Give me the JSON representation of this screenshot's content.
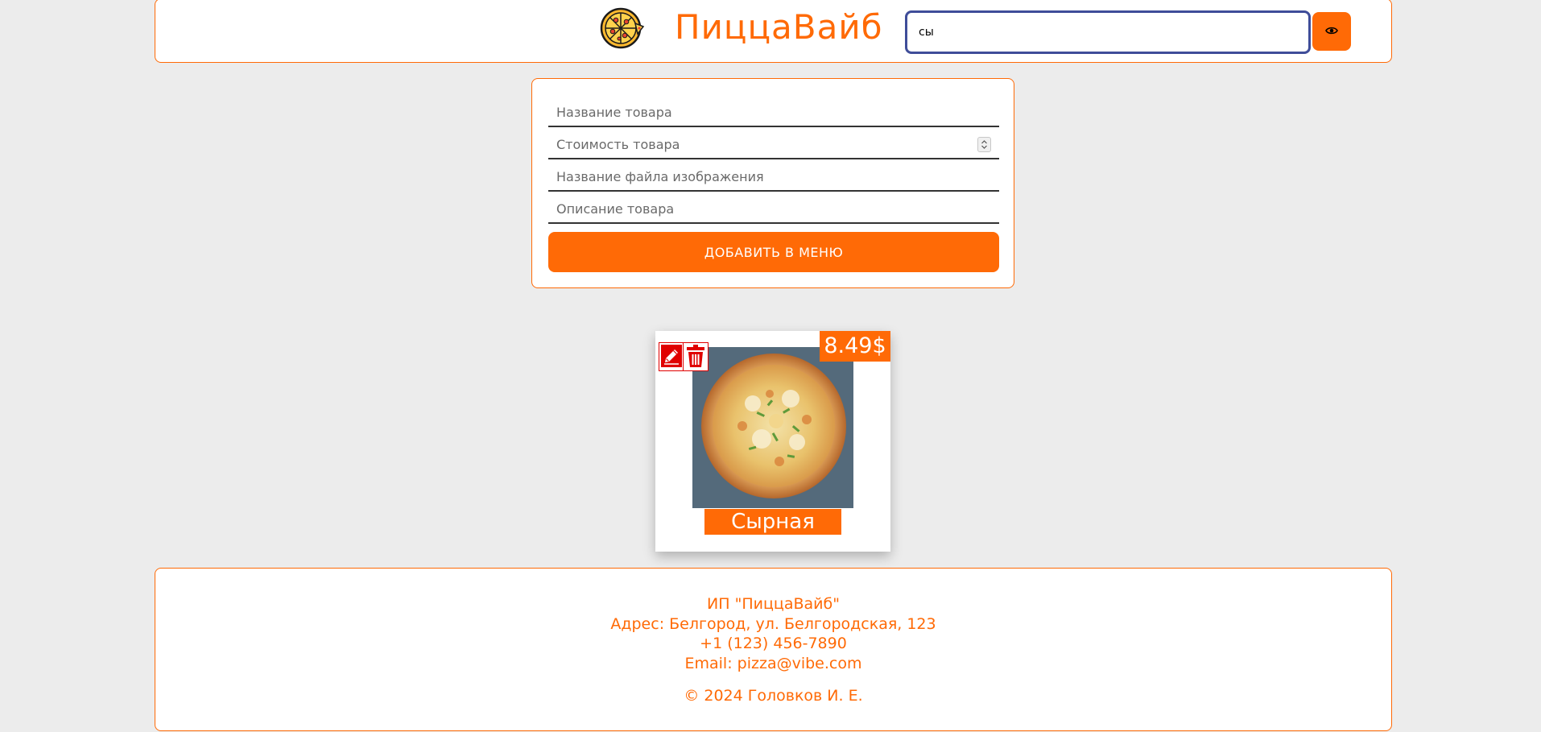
{
  "header": {
    "brand": "ПиццаВайб",
    "search_value": "сы",
    "logo_icon": "pizza-icon",
    "toggle_icon": "eye-icon"
  },
  "form": {
    "name_placeholder": "Название товара",
    "price_placeholder": "Стоимость товара",
    "image_placeholder": "Название файла изображения",
    "description_placeholder": "Описание товара",
    "submit_label": "ДОБАВИТЬ В МЕНЮ"
  },
  "products": [
    {
      "name": "Сырная",
      "price": "8.49$",
      "edit_icon": "pencil-icon",
      "delete_icon": "trash-icon"
    }
  ],
  "footer": {
    "company": "ИП \"ПиццаВайб\"",
    "address": "Адрес: Белгород, ул. Белгородская, 123",
    "phone": "+1 (123) 456-7890",
    "email": "Email: pizza@vibe.com",
    "copyright": "© 2024 Головков И. Е."
  },
  "colors": {
    "accent": "#ff6a06",
    "search_border": "#3f4d99",
    "danger": "#e00000",
    "background": "#ececec"
  }
}
